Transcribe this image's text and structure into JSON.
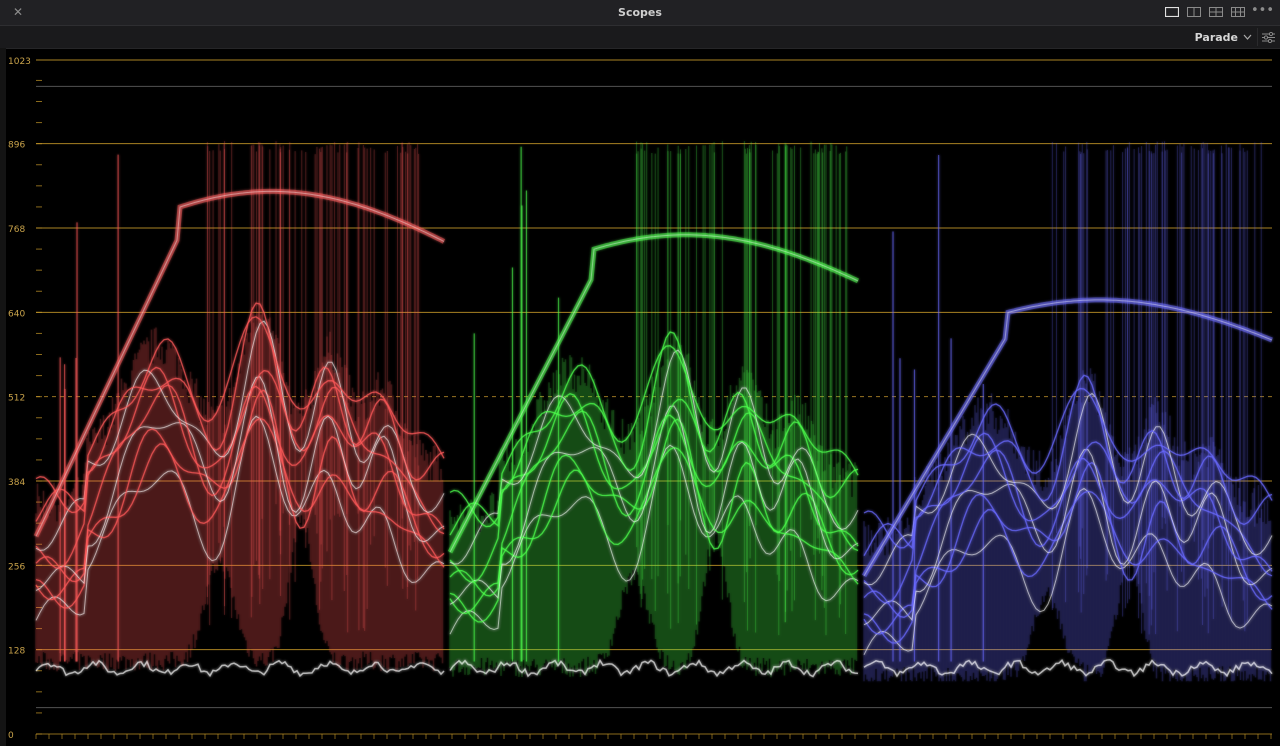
{
  "window": {
    "title": "Scopes",
    "close_glyph": "✕",
    "more_glyph": "•••",
    "layout_icons": [
      "layout-1x1-icon",
      "layout-2x1-icon",
      "layout-2x2-icon",
      "layout-4x-icon"
    ]
  },
  "toolbar": {
    "mode_label": "Parade",
    "mode_icon": "chevron-down-icon",
    "settings_icon": "sliders-icon"
  },
  "scope": {
    "type": "waveform-parade",
    "y_axis_labels": [
      "1023",
      "896",
      "768",
      "640",
      "512",
      "384",
      "256",
      "128",
      "0"
    ],
    "y_axis_values": [
      1023,
      896,
      768,
      640,
      512,
      384,
      256,
      128,
      0
    ],
    "dashed_level": 512,
    "channels": [
      {
        "name": "red",
        "color": "#ff5a5a"
      },
      {
        "name": "green",
        "color": "#4dff4d"
      },
      {
        "name": "blue",
        "color": "#6a6aff"
      }
    ],
    "guide_color": "#c89a2a",
    "guide_color_dashed": "#b48a2a"
  }
}
